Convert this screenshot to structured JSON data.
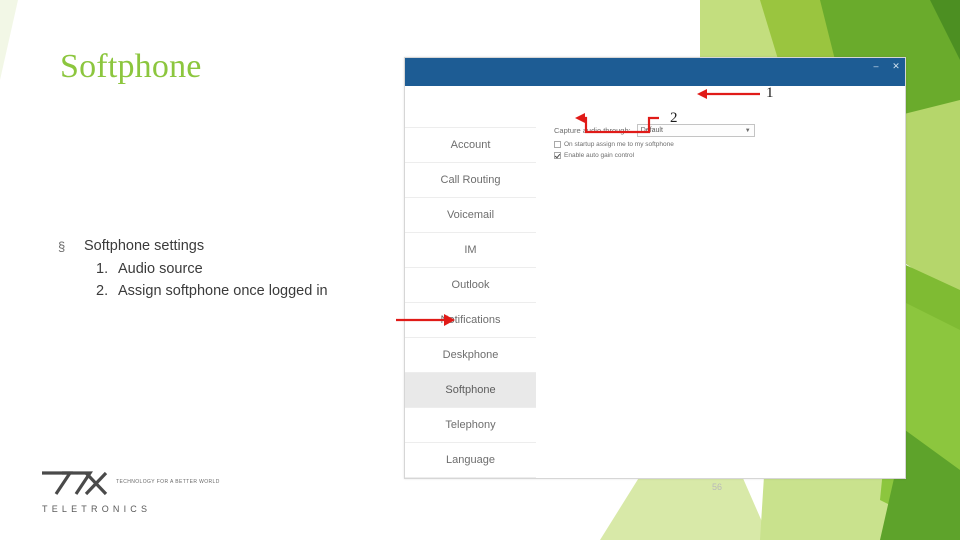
{
  "slide": {
    "title": "Softphone",
    "slide_number": "56",
    "bullet_marker": "§",
    "bullets": [
      {
        "text": "Softphone settings"
      }
    ],
    "sub_items": [
      {
        "num": "1.",
        "text": "Audio source"
      },
      {
        "num": "2.",
        "text": "Assign softphone once logged in"
      }
    ],
    "accent_color": "#8cc63e",
    "annotation_color": "#e01b18"
  },
  "logo": {
    "wordmark": "77X",
    "tagline": "TECHNOLOGY FOR A BETTER WORLD",
    "subtext": "TELETRONICS"
  },
  "annotations": [
    {
      "label": "1",
      "target": "capture-audio-through-select"
    },
    {
      "label": "2",
      "target": "assign-softphone-checkbox"
    }
  ],
  "app": {
    "title_bar": {
      "minimize_icon": "–",
      "close_icon": "✕"
    },
    "nav_items": [
      {
        "label": "Account",
        "selected": false
      },
      {
        "label": "Call Routing",
        "selected": false
      },
      {
        "label": "Voicemail",
        "selected": false
      },
      {
        "label": "IM",
        "selected": false
      },
      {
        "label": "Outlook",
        "selected": false
      },
      {
        "label": "Notifications",
        "selected": false
      },
      {
        "label": "Deskphone",
        "selected": false
      },
      {
        "label": "Softphone",
        "selected": true
      },
      {
        "label": "Telephony",
        "selected": false
      },
      {
        "label": "Language",
        "selected": false
      }
    ],
    "settings": {
      "capture_label": "Capture audio through:",
      "capture_value": "Default",
      "caret_icon": "▼",
      "checkbox_startup": {
        "label": "On startup assign me to my softphone",
        "checked": false
      },
      "checkbox_gain": {
        "label": "Enable auto gain control",
        "checked": true
      }
    }
  }
}
